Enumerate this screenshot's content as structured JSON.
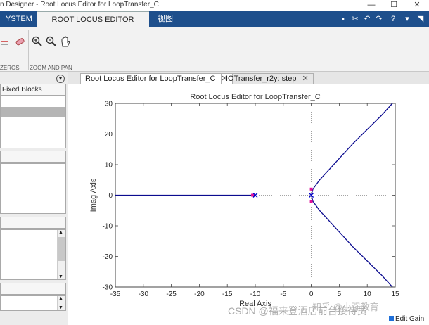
{
  "window": {
    "title": "n Designer - Root Locus Editor for LoopTransfer_C",
    "minimize": "—",
    "maximize": "☐",
    "close": "✕"
  },
  "ribbon": {
    "tabs": [
      {
        "label": "YSTEM",
        "active": false
      },
      {
        "label": "ROOT LOCUS EDITOR",
        "active": true
      },
      {
        "label": "视图",
        "active": false
      }
    ],
    "groups": [
      {
        "label": "ZEROS"
      },
      {
        "label": "ZOOM AND PAN"
      }
    ],
    "buttons": [
      {
        "icon": "delete-pole-zero-icon"
      },
      {
        "icon": "eraser-icon"
      },
      {
        "icon": "zoom-in-icon"
      },
      {
        "icon": "zoom-out-icon"
      },
      {
        "icon": "pan-hand-icon"
      }
    ]
  },
  "left_panel": {
    "section1_header": "Fixed Blocks"
  },
  "doc_tabs": [
    {
      "label": "Root Locus Editor for LoopTransfer_C",
      "close": "✕",
      "active": true
    },
    {
      "label": "IOTransfer_r2y: step",
      "close": "✕",
      "active": false
    }
  ],
  "status": {
    "edit_gain": "Edit Gain"
  },
  "watermark": {
    "zhihu": "知乎 @小强教育",
    "csdn": "CSDN @福来登酒店前台接待员"
  },
  "colors": {
    "accent": "#1e4f8c",
    "locus": "#0b0b8f",
    "pole_marker": "#0000cc",
    "closed_loop_marker": "#e0109a"
  },
  "chart_data": {
    "type": "line",
    "title": "Root Locus Editor for LoopTransfer_C",
    "xlabel": "Real Axis",
    "ylabel": "Imag Axis",
    "xlim": [
      -35,
      15
    ],
    "ylim": [
      -30,
      30
    ],
    "xticks": [
      -35,
      -30,
      -25,
      -20,
      -15,
      -10,
      -5,
      0,
      5,
      10,
      15
    ],
    "yticks": [
      -30,
      -20,
      -10,
      0,
      10,
      20,
      30
    ],
    "grid": false,
    "reference_lines": {
      "x": 0,
      "y": 0,
      "style": "dotted"
    },
    "open_loop_poles": [
      [
        0,
        0
      ],
      [
        -10,
        0
      ]
    ],
    "closed_loop_poles": [
      [
        0,
        2
      ],
      [
        0,
        -2
      ],
      [
        -10.5,
        0
      ]
    ],
    "branches": [
      {
        "name": "real",
        "points": [
          [
            -35,
            0
          ],
          [
            -10,
            0
          ]
        ]
      },
      {
        "name": "upper",
        "points": [
          [
            0,
            0
          ],
          [
            0.3,
            2
          ],
          [
            1.5,
            5
          ],
          [
            3,
            8
          ],
          [
            5,
            12
          ],
          [
            7.5,
            17
          ],
          [
            10,
            21.5
          ],
          [
            12.5,
            26
          ],
          [
            14.5,
            30
          ]
        ]
      },
      {
        "name": "lower",
        "points": [
          [
            0,
            0
          ],
          [
            0.3,
            -2
          ],
          [
            1.5,
            -5
          ],
          [
            3,
            -8
          ],
          [
            5,
            -12
          ],
          [
            7.5,
            -17
          ],
          [
            10,
            -21.5
          ],
          [
            12.5,
            -26
          ],
          [
            14.5,
            -30
          ]
        ]
      }
    ]
  }
}
